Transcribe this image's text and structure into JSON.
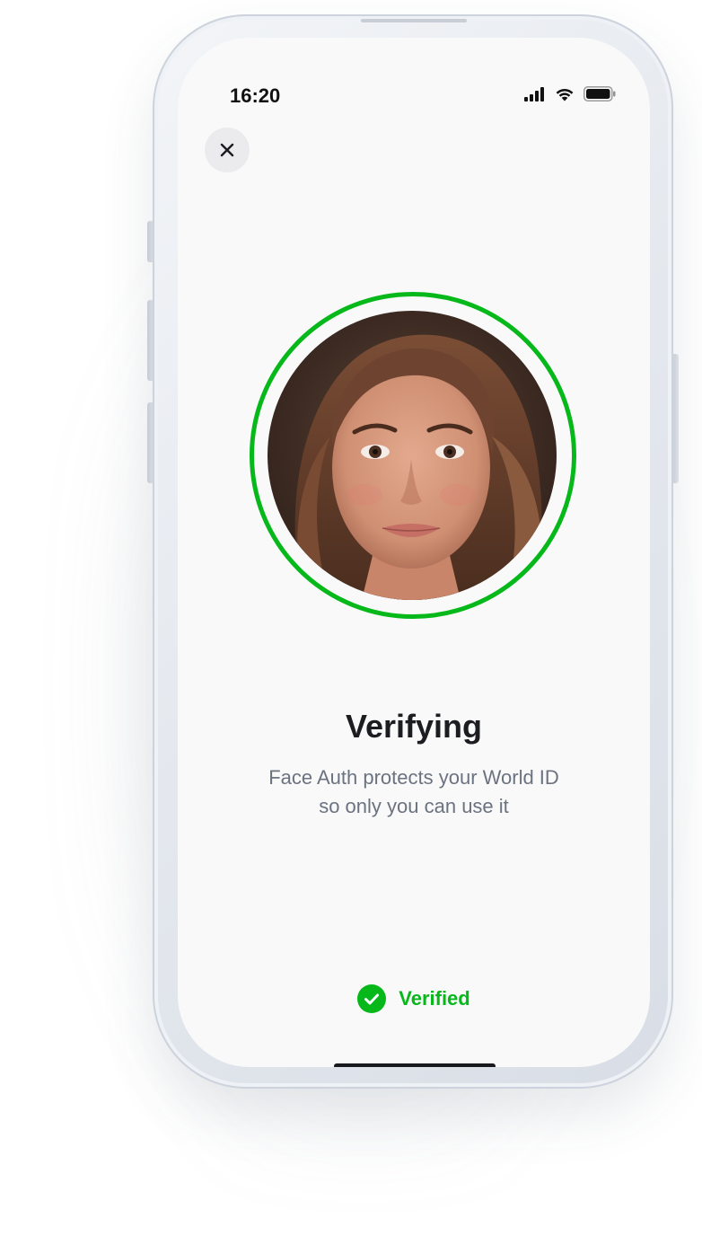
{
  "status_bar": {
    "time": "16:20",
    "icons": [
      "signal-icon",
      "wifi-icon",
      "battery-icon"
    ]
  },
  "close_button": {
    "icon": "close-icon"
  },
  "face": {
    "description_icon": "face-photo",
    "ring_color": "#06b81a"
  },
  "main": {
    "title": "Verifying",
    "subtitle_line1": "Face Auth protects your World ID",
    "subtitle_line2": "so only you can use it"
  },
  "status": {
    "label": "Verified",
    "icon": "check-circle-icon",
    "color": "#06b81a"
  }
}
